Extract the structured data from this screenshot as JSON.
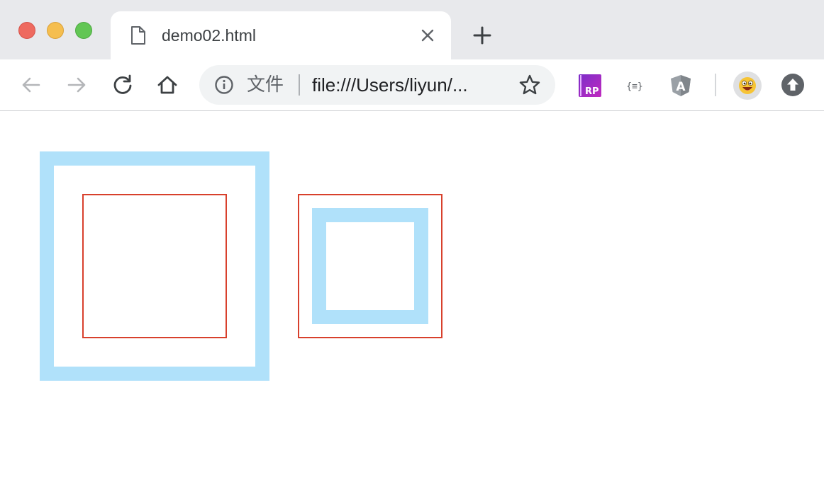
{
  "window": {
    "controls": [
      "close",
      "minimize",
      "zoom"
    ],
    "colors": {
      "close": "#ee6a5f",
      "minimize": "#f5be4f",
      "zoom": "#62c654"
    }
  },
  "tab": {
    "title": "demo02.html",
    "icon": "file-icon",
    "close_icon": "close-icon"
  },
  "new_tab_icon": "plus-icon",
  "toolbar": {
    "back_icon": "arrow-left-icon",
    "forward_icon": "arrow-right-icon",
    "reload_icon": "reload-icon",
    "home_icon": "home-icon"
  },
  "omnibox": {
    "info_icon": "info-icon",
    "scheme_label": "文件",
    "url": "file:///Users/liyun/...",
    "bookmark_icon": "star-icon"
  },
  "extensions": [
    {
      "name": "axure-rp-extension",
      "icon": "rp-icon",
      "label": "RP"
    },
    {
      "name": "json-formatter-extension",
      "icon": "braces-icon",
      "label": "{≡}"
    },
    {
      "name": "angular-extension",
      "icon": "angular-icon",
      "label": "A"
    }
  ],
  "profile": {
    "icon": "emoji-avatar-icon"
  },
  "update_icon": "upload-arrow-icon",
  "page": {
    "border_color_blue": "#b0e1fa",
    "border_color_red": "#d8402c"
  }
}
